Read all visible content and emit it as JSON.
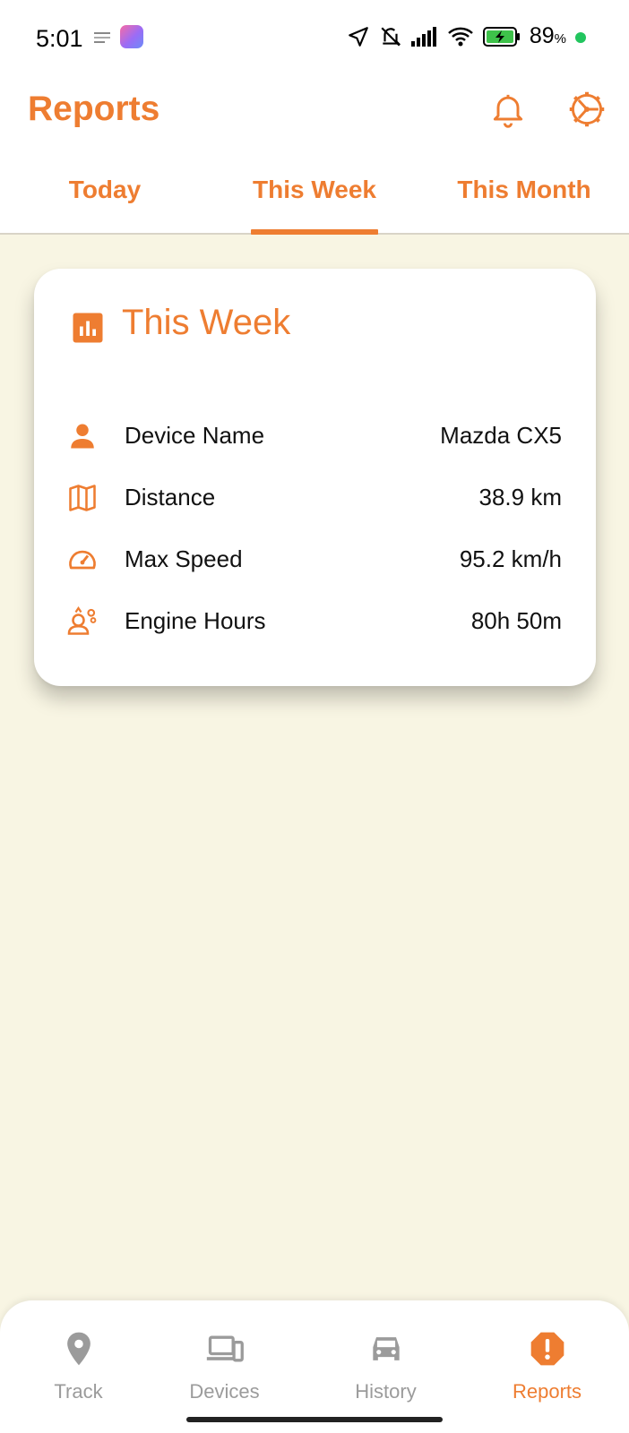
{
  "status_bar": {
    "time": "5:01",
    "battery_percent": "89",
    "battery_unit": "%",
    "icons": [
      "location-arrow-icon",
      "bell-off-icon",
      "signal-icon",
      "wifi-icon",
      "battery-charging-icon"
    ]
  },
  "header": {
    "title": "Reports",
    "notification_icon": "bell-icon",
    "settings_icon": "settings-wheel-icon"
  },
  "tabs": {
    "items": [
      {
        "label": "Today"
      },
      {
        "label": "This Week"
      },
      {
        "label": "This Month"
      }
    ],
    "active_index": 1
  },
  "card": {
    "title": "This Week",
    "title_icon": "bar-chart-icon",
    "rows": [
      {
        "icon": "person-icon",
        "label": "Device Name",
        "value": "Mazda CX5"
      },
      {
        "icon": "map-icon",
        "label": "Distance",
        "value": "38.9 km"
      },
      {
        "icon": "speedometer-icon",
        "label": "Max Speed",
        "value": "95.2 km/h"
      },
      {
        "icon": "engine-hours-icon",
        "label": "Engine Hours",
        "value": "80h 50m"
      }
    ]
  },
  "bottom_nav": {
    "items": [
      {
        "label": "Track",
        "icon": "location-pin-icon"
      },
      {
        "label": "Devices",
        "icon": "devices-icon"
      },
      {
        "label": "History",
        "icon": "car-icon"
      },
      {
        "label": "Reports",
        "icon": "alert-octagon-icon"
      }
    ],
    "active_index": 3
  },
  "colors": {
    "accent": "#ee7d31",
    "background": "#f8f5e3",
    "inactive": "#9b9b9b"
  }
}
